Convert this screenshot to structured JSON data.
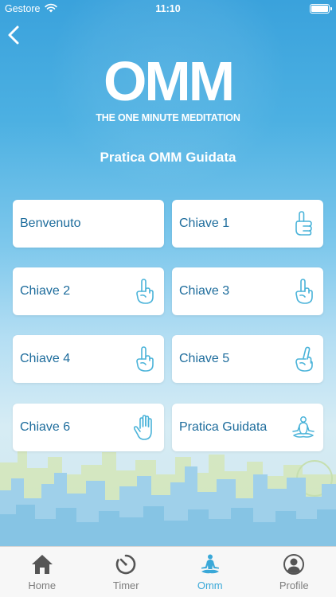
{
  "status_bar": {
    "carrier": "Gestore",
    "time": "11:10"
  },
  "logo": {
    "main": "OMM",
    "subtitle": "THE ONE MINUTE MEDITATION"
  },
  "title": "Pratica OMM Guidata",
  "cards": [
    {
      "label": "Benvenuto",
      "icon": ""
    },
    {
      "label": "Chiave 1",
      "icon": "thumbs-up-hand-icon"
    },
    {
      "label": "Chiave 2",
      "icon": "index-finger-hand-icon"
    },
    {
      "label": "Chiave 3",
      "icon": "index-finger-hand-icon"
    },
    {
      "label": "Chiave 4",
      "icon": "index-finger-hand-icon"
    },
    {
      "label": "Chiave 5",
      "icon": "index-finger-hand-icon"
    },
    {
      "label": "Chiave 6",
      "icon": "open-hand-icon"
    },
    {
      "label": "Pratica Guidata",
      "icon": "meditation-pose-icon"
    }
  ],
  "tabs": [
    {
      "label": "Home",
      "icon": "home-icon",
      "active": false
    },
    {
      "label": "Timer",
      "icon": "timer-icon",
      "active": false
    },
    {
      "label": "Omm",
      "icon": "meditation-pose-icon",
      "active": true
    },
    {
      "label": "Profile",
      "icon": "profile-icon",
      "active": false
    }
  ],
  "colors": {
    "sky_top": "#3aa2dc",
    "card_text": "#1d6c9c",
    "icon_stroke": "#4ab3d9",
    "tab_active": "#3aa8d8",
    "tab_inactive": "#555555"
  }
}
